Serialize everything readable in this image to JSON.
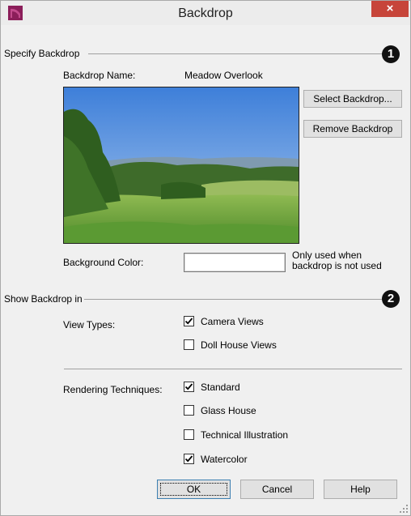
{
  "window": {
    "title": "Backdrop",
    "close_glyph": "×",
    "app_icon": "chief-architect-logo-icon"
  },
  "specify": {
    "group_label": "Specify Backdrop",
    "badge": "1",
    "name_label": "Backdrop Name:",
    "name_value": "Meadow Overlook",
    "select_button": "Select Backdrop...",
    "remove_button": "Remove Backdrop",
    "preview": "meadow-landscape-image",
    "bg_color_label": "Background Color:",
    "bg_color_value": "#ffffff",
    "bg_note_line1": "Only used when",
    "bg_note_line2": "backdrop is not used"
  },
  "show": {
    "group_label": "Show Backdrop in",
    "badge": "2",
    "view_types_label": "View Types:",
    "view_types": [
      {
        "label": "Camera Views",
        "checked": true
      },
      {
        "label": "Doll House Views",
        "checked": false
      }
    ],
    "rendering_label": "Rendering Techniques:",
    "rendering": [
      {
        "label": "Standard",
        "checked": true
      },
      {
        "label": "Glass House",
        "checked": false
      },
      {
        "label": "Technical Illustration",
        "checked": false
      },
      {
        "label": "Watercolor",
        "checked": true
      }
    ]
  },
  "buttons": {
    "ok": "OK",
    "cancel": "Cancel",
    "help": "Help"
  },
  "colors": {
    "close": "#c7453a",
    "dialog_bg": "#f0f0f0",
    "badge": "#111111"
  }
}
